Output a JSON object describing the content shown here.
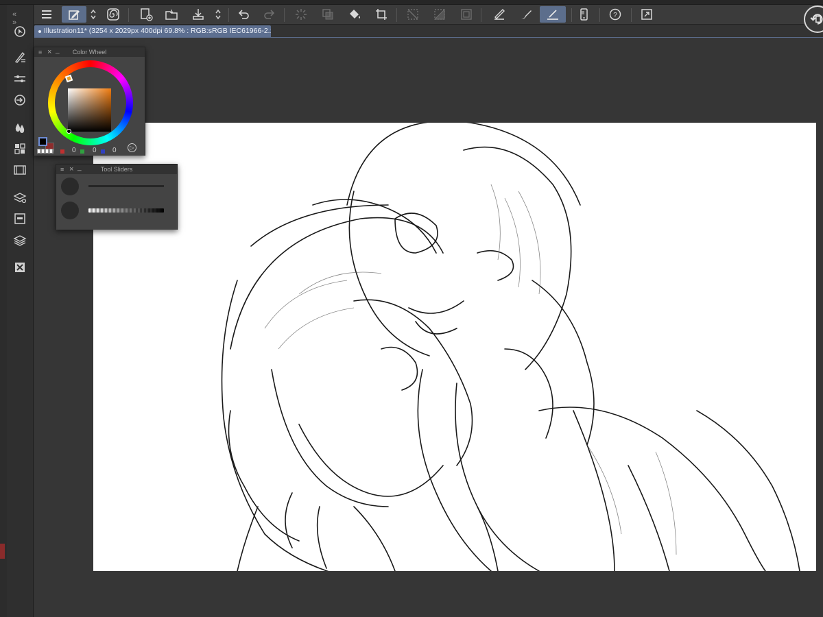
{
  "document": {
    "tab_label": "Illustration11* (3254 x 2029px 400dpi 69.8% : RGB:sRGB IEC61966-2.1)"
  },
  "toolbar": {
    "items": [
      {
        "icon": "menu-icon"
      },
      {
        "icon": "edit-mode-icon",
        "active": true
      },
      {
        "icon": "mode-switch-chevrons-icon"
      },
      {
        "icon": "spiral-app-icon"
      },
      {
        "icon": "new-canvas-icon"
      },
      {
        "icon": "open-folder-icon"
      },
      {
        "icon": "save-icon"
      },
      {
        "icon": "save-options-chevrons-icon"
      },
      {
        "icon": "undo-icon"
      },
      {
        "icon": "redo-icon",
        "disabled": true
      },
      {
        "icon": "loading-spinner-icon",
        "disabled": true
      },
      {
        "icon": "copy-layer-icon",
        "disabled": true
      },
      {
        "icon": "fill-bucket-icon"
      },
      {
        "icon": "crop-icon"
      },
      {
        "icon": "clear-selection-icon",
        "disabled": true
      },
      {
        "icon": "invert-selection-icon",
        "disabled": true
      },
      {
        "icon": "selection-border-icon",
        "disabled": true
      },
      {
        "icon": "ruler-pen-icon"
      },
      {
        "icon": "brush-pen-icon"
      },
      {
        "icon": "snap-ruler-icon",
        "active": true
      },
      {
        "icon": "smartphone-icon"
      },
      {
        "icon": "help-icon"
      },
      {
        "icon": "fullscreen-icon"
      }
    ]
  },
  "left_panel": {
    "collapse_label": "«  »",
    "icons": [
      "navigator-icon",
      "brush-tool-icon",
      "tool-property-icon",
      "sub-tool-icon",
      "color-drops-icon",
      "color-grid-icon",
      "animation-icon",
      "layer-property-icon",
      "frame-icon",
      "layers-icon",
      "delete-icon"
    ]
  },
  "color_wheel": {
    "title": "Color Wheel",
    "hue_color": "#F07C10",
    "main_color": "#000000",
    "sub_color": "#8C2D2D",
    "r": "0",
    "g": "0",
    "b": "0"
  },
  "tool_sliders": {
    "title": "Tool Sliders"
  }
}
